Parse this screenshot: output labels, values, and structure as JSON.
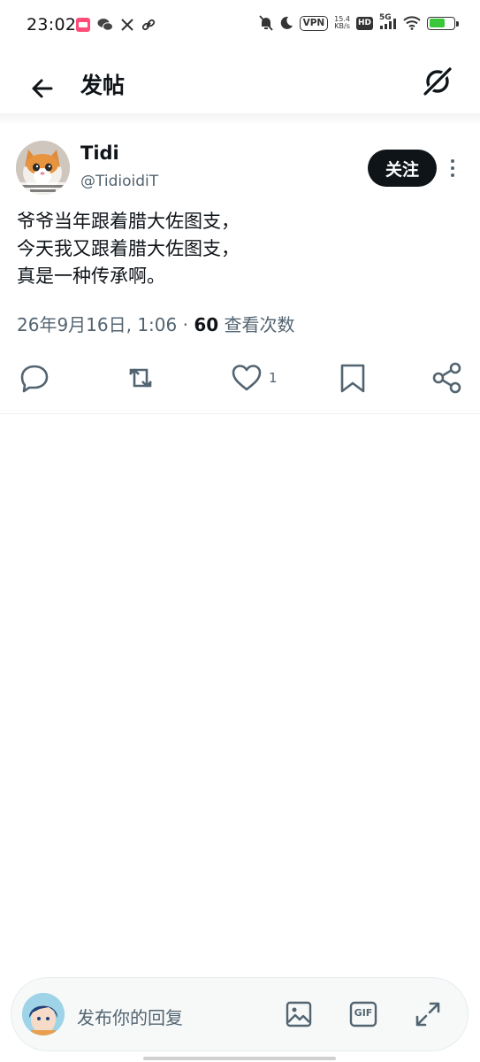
{
  "status_bar": {
    "time": "23:02",
    "vpn_label": "VPN",
    "net_speed": "15.4",
    "net_unit": "KB/s",
    "hd_label": "HD",
    "network": "5G",
    "battery_level": 0.65,
    "battery_color": "#3ac83a"
  },
  "header": {
    "title": "发帖",
    "back_icon": "arrow-left-icon",
    "grok_icon": "grok-icon"
  },
  "post": {
    "author_name": "Tidi",
    "author_handle": "@TidioidiT",
    "follow_label": "关注",
    "lines": [
      "爷爷当年跟着腊大佐图支，",
      "今天我又跟着腊大佐图支，",
      "真是一种传承啊。"
    ],
    "timestamp": "26年9月16日, 1:06",
    "separator": " · ",
    "views_count": "60",
    "views_label": " 查看次数",
    "like_count": "1"
  },
  "reply": {
    "placeholder": "发布你的回复",
    "gif_label": "GIF"
  },
  "colors": {
    "text": "#0f1419",
    "secondary": "#536471",
    "follow_bg": "#0f1419"
  }
}
